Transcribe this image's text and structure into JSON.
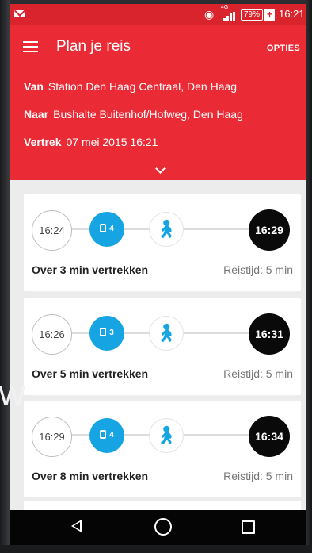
{
  "status_bar": {
    "network": "4G",
    "battery": "79%",
    "time": "16:21"
  },
  "header": {
    "title": "Plan je reis",
    "options_label": "OPTIES",
    "from_label": "Van",
    "from_value": "Station Den Haag Centraal, Den Haag",
    "to_label": "Naar",
    "to_value": "Bushalte Buitenhof/Hofweg, Den Haag",
    "departure_label": "Vertrek",
    "departure_value": "07 mei 2015 16:21"
  },
  "trips": [
    {
      "departure_time": "16:24",
      "line": "4",
      "arrival_time": "16:29",
      "depart_in": "Over 3 min vertrekken",
      "duration": "Reistijd: 5 min"
    },
    {
      "departure_time": "16:26",
      "line": "3",
      "arrival_time": "16:31",
      "depart_in": "Over 5 min vertrekken",
      "duration": "Reistijd: 5 min"
    },
    {
      "departure_time": "16:29",
      "line": "4",
      "arrival_time": "16:34",
      "depart_in": "Over 8 min vertrekken",
      "duration": "Reistijd: 5 min"
    }
  ],
  "background_text": "W",
  "colors": {
    "accent": "#ea2b36",
    "bus": "#16a4e3",
    "arrival": "#0a0a0a"
  }
}
